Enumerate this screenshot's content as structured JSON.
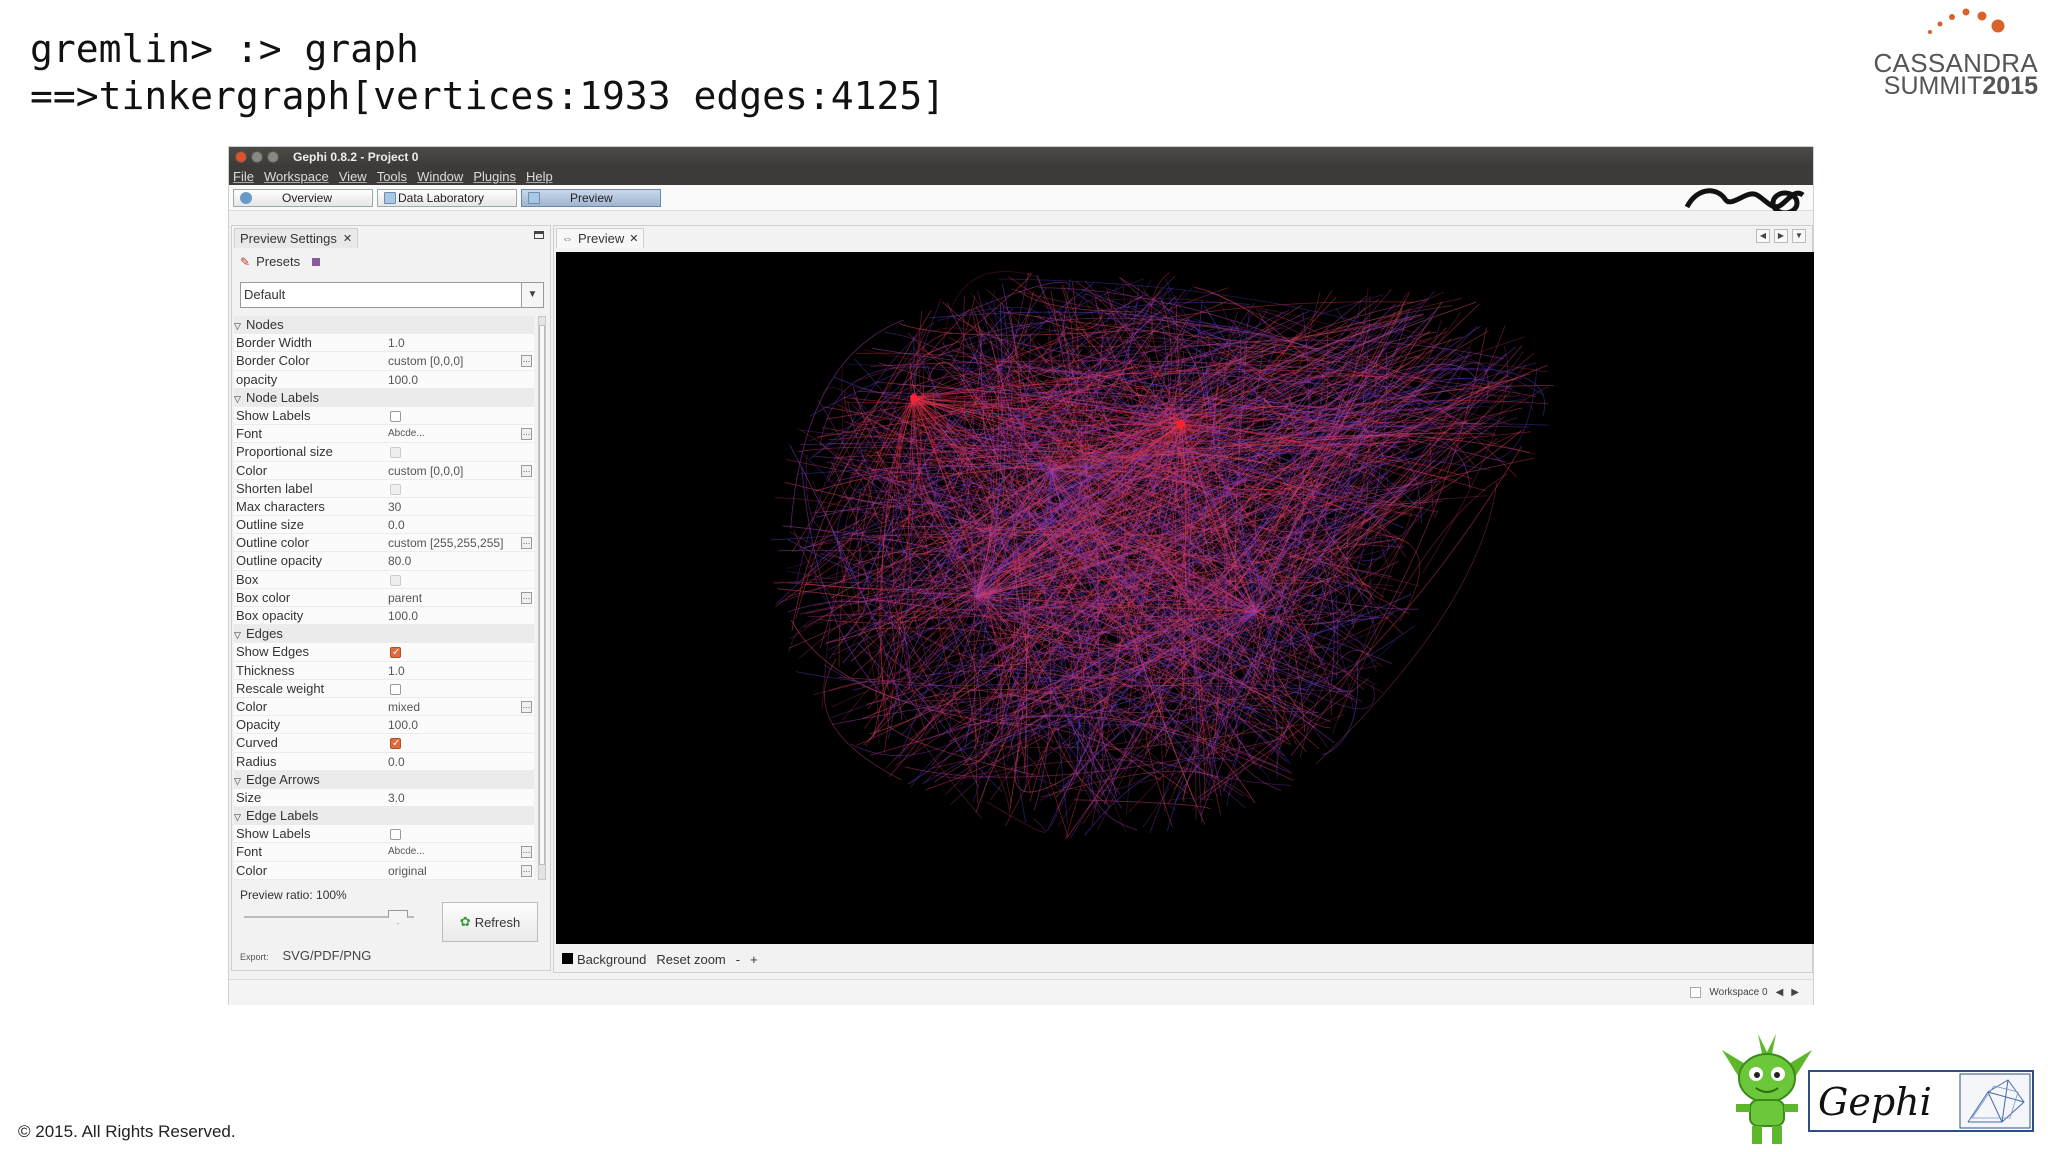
{
  "slide": {
    "console_line1": "gremlin> :> graph",
    "console_line2": "==>tinkergraph[vertices:1933 edges:4125]",
    "copyright": "© 2015. All Rights Reserved.",
    "brand_line1": "CASSANDRA",
    "brand_line2a": "SUMMIT",
    "brand_line2b": "2015",
    "brand_accent": "#d9622b",
    "gephi_logo_text": "Gephi"
  },
  "window": {
    "title": "Gephi 0.8.2 - Project 0",
    "menu": [
      "File",
      "Workspace",
      "View",
      "Tools",
      "Window",
      "Plugins",
      "Help"
    ],
    "tabs": [
      {
        "label": "Overview"
      },
      {
        "label": "Data Laboratory"
      },
      {
        "label": "Preview"
      }
    ]
  },
  "settings": {
    "panel_title": "Preview Settings",
    "presets_label": "Presets",
    "preset_value": "Default",
    "rows": [
      {
        "type": "cat",
        "name": "Nodes"
      },
      {
        "type": "text",
        "name": "Border Width",
        "value": "1.0"
      },
      {
        "type": "text",
        "name": "Border Color",
        "value": "custom [0,0,0]",
        "more": true
      },
      {
        "type": "text",
        "name": "opacity",
        "value": "100.0"
      },
      {
        "type": "cat",
        "name": "Node Labels"
      },
      {
        "type": "check",
        "name": "Show Labels",
        "checked": false
      },
      {
        "type": "text",
        "name": "Font",
        "value": "Abcde...",
        "more": true,
        "small": true
      },
      {
        "type": "check",
        "name": "Proportional size",
        "checked": false,
        "disabled": true
      },
      {
        "type": "text",
        "name": "Color",
        "value": "custom [0,0,0]",
        "more": true
      },
      {
        "type": "check",
        "name": "Shorten label",
        "checked": false,
        "disabled": true
      },
      {
        "type": "text",
        "name": "Max characters",
        "value": "30"
      },
      {
        "type": "text",
        "name": "Outline size",
        "value": "0.0"
      },
      {
        "type": "text",
        "name": "Outline color",
        "value": "custom [255,255,255]",
        "more": true
      },
      {
        "type": "text",
        "name": "Outline opacity",
        "value": "80.0"
      },
      {
        "type": "check",
        "name": "Box",
        "checked": false,
        "disabled": true
      },
      {
        "type": "text",
        "name": "Box color",
        "value": "parent",
        "more": true
      },
      {
        "type": "text",
        "name": "Box opacity",
        "value": "100.0"
      },
      {
        "type": "cat",
        "name": "Edges"
      },
      {
        "type": "check",
        "name": "Show Edges",
        "checked": true
      },
      {
        "type": "text",
        "name": "Thickness",
        "value": "1.0"
      },
      {
        "type": "check",
        "name": "Rescale weight",
        "checked": false
      },
      {
        "type": "text",
        "name": "Color",
        "value": "mixed",
        "more": true
      },
      {
        "type": "text",
        "name": "Opacity",
        "value": "100.0"
      },
      {
        "type": "check",
        "name": "Curved",
        "checked": true
      },
      {
        "type": "text",
        "name": "Radius",
        "value": "0.0"
      },
      {
        "type": "cat",
        "name": "Edge Arrows"
      },
      {
        "type": "text",
        "name": "Size",
        "value": "3.0"
      },
      {
        "type": "cat",
        "name": "Edge Labels"
      },
      {
        "type": "check",
        "name": "Show Labels",
        "checked": false
      },
      {
        "type": "text",
        "name": "Font",
        "value": "Abcde...",
        "more": true,
        "small": true
      },
      {
        "type": "text",
        "name": "Color",
        "value": "original",
        "more": true
      }
    ],
    "preview_ratio": "Preview ratio: 100%",
    "refresh_label": "Refresh",
    "export_label": "Export:",
    "export_value": "SVG/PDF/PNG"
  },
  "preview": {
    "tab_label": "Preview",
    "background_label": "Background",
    "reset_zoom_label": "Reset zoom",
    "zoom_out_label": "-",
    "zoom_in_label": "+",
    "edge_colors": [
      "#e0405a",
      "#c0306a",
      "#8a3ac8",
      "#5a40d8",
      "#d84860",
      "#a03aa8"
    ],
    "hub_color": "#ff2030"
  },
  "status": {
    "workspace_label": "Workspace 0"
  }
}
